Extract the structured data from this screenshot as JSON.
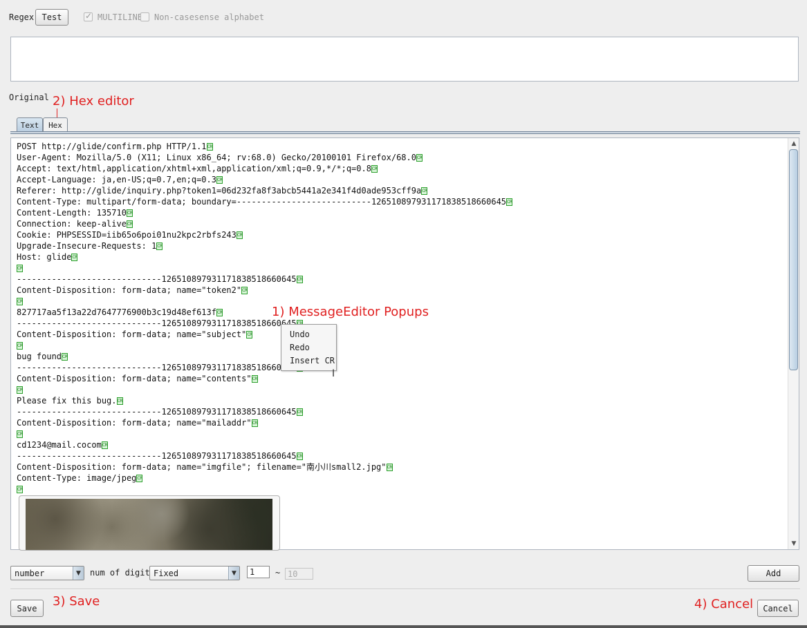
{
  "toolbar": {
    "regex_label": "Regex",
    "test_button": "Test",
    "multiline_label": "MULTILINE",
    "multiline_checked": true,
    "noncasesense_label": "Non-casesense alphabet",
    "noncasesense_checked": false
  },
  "original_label": "Original",
  "tabs": [
    {
      "label": "Text",
      "active": true
    },
    {
      "label": "Hex",
      "active": false
    }
  ],
  "editor": {
    "cr_marker": "CR",
    "lines": [
      "POST http://glide/confirm.php HTTP/1.1",
      "User-Agent: Mozilla/5.0 (X11; Linux x86_64; rv:68.0) Gecko/20100101 Firefox/68.0",
      "Accept: text/html,application/xhtml+xml,application/xml;q=0.9,*/*;q=0.8",
      "Accept-Language: ja,en-US;q=0.7,en;q=0.3",
      "Referer: http://glide/inquiry.php?token1=06d232fa8f3abcb5441a2e341f4d0ade953cff9a",
      "Content-Type: multipart/form-data; boundary=---------------------------126510897931171838518660645",
      "Content-Length: 135710",
      "Connection: keep-alive",
      "Cookie: PHPSESSID=iib65o6poi01nu2kpc2rbfs243",
      "Upgrade-Insecure-Requests: 1",
      "Host: glide",
      "",
      "-----------------------------126510897931171838518660645",
      "Content-Disposition: form-data; name=\"token2\"",
      "",
      "827717aa5f13a22d7647776900b3c19d48ef613f",
      "-----------------------------126510897931171838518660645",
      "Content-Disposition: form-data; name=\"subject\"",
      "",
      "bug found",
      "-----------------------------126510897931171838518660645",
      "Content-Disposition: form-data; name=\"contents\"",
      "",
      "Please fix this bug.",
      "-----------------------------126510897931171838518660645",
      "Content-Disposition: form-data; name=\"mailaddr\"",
      "",
      "cd1234@mail.cocom",
      "-----------------------------126510897931171838518660645",
      "Content-Disposition: form-data; name=\"imgfile\"; filename=\"南小川small2.jpg\"",
      "Content-Type: image/jpeg",
      ""
    ]
  },
  "popup": {
    "items": [
      "Undo",
      "Redo",
      "Insert CR"
    ]
  },
  "annotations": {
    "popups": "1) MessageEditor Popups",
    "hex": "2) Hex editor",
    "save": "3) Save",
    "cancel": "4) Cancel"
  },
  "bottom": {
    "type_select": "number",
    "num_digits_label": "num of digits",
    "digits_select": "Fixed",
    "min_value": "1",
    "range_sep": "~",
    "max_value": "10",
    "add_button": "Add",
    "save_button": "Save",
    "cancel_button": "Cancel"
  },
  "colors": {
    "annotation": "#e02020",
    "cr_marker_border": "#2c9e2c",
    "cr_marker_fill": "#d8f6d8",
    "tab_active": "#b9cde0"
  }
}
